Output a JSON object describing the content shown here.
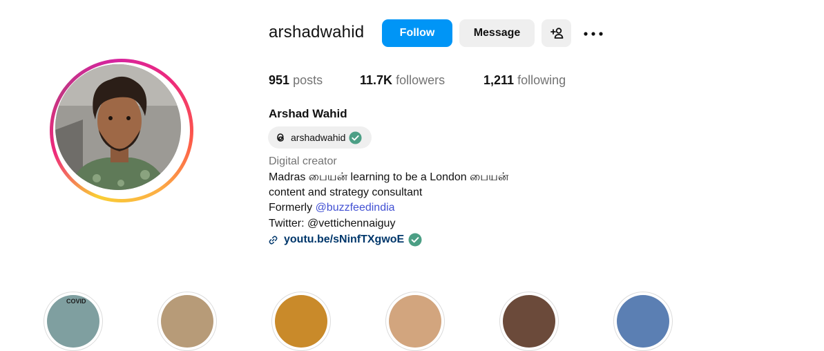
{
  "profile": {
    "username": "arshadwahid",
    "full_name": "Arshad Wahid",
    "threads_handle": "arshadwahid",
    "category": "Digital creator",
    "bio": {
      "line1": "Madras பையன் learning to be a London பையன்",
      "line2": "content and strategy consultant",
      "line3_prefix": "Formerly ",
      "line3_mention": "@buzzfeedindia",
      "line4": "Twitter: @vettichennaiguy"
    },
    "link": "youtu.be/sNinfTXgwoE"
  },
  "actions": {
    "follow_label": "Follow",
    "message_label": "Message"
  },
  "stats": {
    "posts_count": "951",
    "posts_label": "posts",
    "followers_count": "11.7K",
    "followers_label": "followers",
    "following_count": "1,211",
    "following_label": "following"
  },
  "highlights": {
    "first_label_fragment": "COVID"
  },
  "colors": {
    "primary_blue": "#0095f6",
    "secondary_button": "#efefef",
    "link_navy": "#00376b",
    "mention_blue": "#4150d3",
    "verified_green": "#4c9f85",
    "muted_text": "#737373"
  },
  "icons": [
    "add-person-icon",
    "more-dots-icon",
    "threads-icon",
    "verified-badge-icon",
    "link-icon"
  ]
}
